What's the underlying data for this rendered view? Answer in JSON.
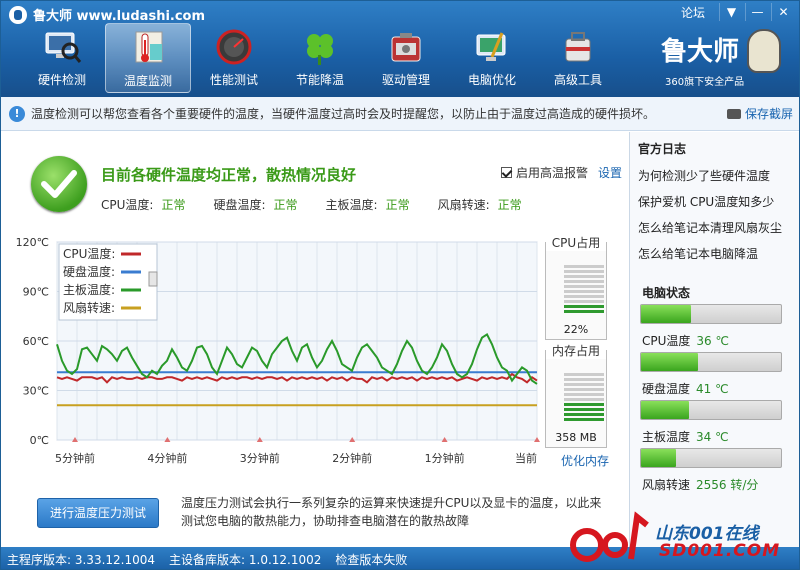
{
  "app": {
    "title": "鲁大师 www.ludashi.com",
    "forum_link": "论坛",
    "win_controls": {
      "menu": "▼",
      "minimize": "—",
      "close": "✕"
    },
    "brand": "鲁大师",
    "brand_sub": "360旗下安全产品"
  },
  "nav": [
    {
      "label": "硬件检测",
      "icon": "monitor-magnifier-icon",
      "active": false
    },
    {
      "label": "温度监测",
      "icon": "thermometer-icon",
      "active": true
    },
    {
      "label": "性能测试",
      "icon": "gauge-icon",
      "active": false
    },
    {
      "label": "节能降温",
      "icon": "clover-icon",
      "active": false
    },
    {
      "label": "驱动管理",
      "icon": "toolbox-icon",
      "active": false
    },
    {
      "label": "电脑优化",
      "icon": "broom-monitor-icon",
      "active": false
    },
    {
      "label": "高级工具",
      "icon": "toolkit-icon",
      "active": false
    }
  ],
  "infobar": {
    "text": "温度检测可以帮您查看各个重要硬件的温度，当硬件温度过高时会及时提醒您，以防止由于温度过高造成的硬件损坏。",
    "save_label": "保存截屏"
  },
  "status": {
    "title": "目前各硬件温度均正常，散热情况良好",
    "items": [
      {
        "label": "CPU温度:",
        "value": "正常"
      },
      {
        "label": "硬盘温度:",
        "value": "正常"
      },
      {
        "label": "主板温度:",
        "value": "正常"
      },
      {
        "label": "风扇转速:",
        "value": "正常"
      }
    ],
    "alarm_label": "启用高温报警",
    "settings_label": "设置"
  },
  "chart_data": {
    "type": "line",
    "ylim": [
      0,
      120
    ],
    "ytick_labels": [
      "120℃",
      "90℃",
      "60℃",
      "30℃",
      "0℃"
    ],
    "yticks": [
      120,
      90,
      60,
      30,
      0
    ],
    "x_categories": [
      "5分钟前",
      "4分钟前",
      "3分钟前",
      "2分钟前",
      "1分钟前",
      "当前"
    ],
    "legend": [
      {
        "name": "CPU温度:",
        "color": "#c0282a"
      },
      {
        "name": "硬盘温度:",
        "color": "#3a7cd0"
      },
      {
        "name": "主板温度:",
        "color": "#2a9a2a"
      },
      {
        "name": "风扇转速:",
        "color": "#c8a020"
      }
    ],
    "series": [
      {
        "name": "CPU温度",
        "color": "#c0282a",
        "values": [
          38,
          37,
          38,
          37,
          36,
          38,
          38,
          38,
          37,
          38,
          35,
          38,
          37,
          38,
          37,
          37,
          38,
          37,
          38,
          38,
          37,
          37,
          38,
          38,
          37,
          36,
          38,
          37,
          38,
          37,
          38,
          37,
          36,
          38,
          37,
          38,
          37,
          38,
          38,
          37,
          38,
          37,
          38,
          38,
          37,
          38,
          36,
          38,
          37,
          38,
          37,
          38,
          37,
          38,
          36,
          38,
          37,
          38,
          36,
          38,
          37,
          37,
          35,
          38,
          37,
          38,
          36,
          38,
          37,
          38,
          37,
          38,
          36,
          38,
          37,
          38,
          37,
          38,
          37,
          38,
          36,
          37,
          38,
          37,
          36,
          38,
          37,
          38,
          37,
          38,
          37,
          40,
          38,
          37,
          35,
          38,
          36
        ]
      },
      {
        "name": "硬盘温度",
        "color": "#3a7cd0",
        "values": [
          41,
          41,
          41,
          41,
          41,
          41,
          41,
          41,
          41,
          41,
          41,
          41,
          41,
          41,
          41,
          41,
          41,
          41,
          41,
          41,
          41,
          41,
          41,
          41,
          41,
          41,
          41,
          41,
          41,
          41,
          41,
          41,
          41,
          41,
          41,
          41,
          41,
          41,
          41,
          41,
          41,
          41,
          41,
          41,
          41,
          41,
          41,
          41,
          41,
          41,
          41,
          41,
          41,
          41,
          41,
          41,
          41,
          41,
          41,
          41,
          41,
          41,
          41,
          41,
          41,
          41,
          41,
          41,
          41,
          41,
          41,
          41,
          41,
          41,
          41,
          41,
          41,
          41,
          41,
          41,
          41,
          41,
          41,
          41,
          41,
          41,
          41,
          41,
          41,
          41,
          41,
          41,
          41,
          41,
          41,
          41,
          41
        ]
      },
      {
        "name": "主板温度",
        "color": "#2a9a2a",
        "values": [
          58,
          48,
          42,
          40,
          43,
          55,
          56,
          52,
          48,
          57,
          55,
          52,
          48,
          54,
          56,
          50,
          45,
          40,
          38,
          42,
          40,
          45,
          48,
          55,
          50,
          44,
          42,
          48,
          56,
          57,
          52,
          44,
          40,
          48,
          56,
          52,
          46,
          44,
          50,
          56,
          54,
          48,
          44,
          52,
          56,
          60,
          62,
          54,
          48,
          56,
          58,
          50,
          44,
          48,
          55,
          60,
          54,
          46,
          44,
          42,
          50,
          56,
          58,
          54,
          50,
          44,
          42,
          40,
          46,
          54,
          60,
          56,
          48,
          42,
          40,
          44,
          50,
          58,
          54,
          46,
          40,
          38,
          40,
          46,
          55,
          62,
          64,
          58,
          50,
          44,
          42,
          36,
          40,
          44,
          42,
          36,
          34
        ]
      },
      {
        "name": "风扇转速",
        "color": "#c8a020",
        "values": [
          21,
          21,
          21,
          21,
          21,
          21,
          21,
          21,
          21,
          21,
          21,
          21,
          21,
          21,
          21,
          21,
          21,
          21,
          21,
          21,
          21,
          21,
          21,
          21,
          21,
          21,
          21,
          21,
          21,
          21,
          21,
          21,
          21,
          21,
          21,
          21,
          21,
          21,
          21,
          21,
          21,
          21,
          21,
          21,
          21,
          21,
          21,
          21,
          21,
          21,
          21,
          21,
          21,
          21,
          21,
          21,
          21,
          21,
          21,
          21,
          21,
          21,
          21,
          21,
          21,
          21,
          21,
          21,
          21,
          21,
          21,
          21,
          21,
          21,
          21,
          21,
          21,
          21,
          21,
          21,
          21,
          21,
          21,
          21,
          21,
          21,
          21,
          21,
          21,
          21,
          21,
          21,
          21,
          21,
          21,
          21,
          21
        ]
      }
    ]
  },
  "cpu_usage": {
    "caption": "CPU占用",
    "value": "22%",
    "fraction": 0.22
  },
  "mem_usage": {
    "caption": "内存占用",
    "value": "358 MB",
    "fraction": 0.35
  },
  "optimize_mem": "优化内存",
  "stress": {
    "button": "进行温度压力测试",
    "desc": "温度压力测试会执行一系列复杂的运算来快速提升CPU以及显卡的温度，以此来测试您电脑的散热能力，协助排查电脑潜在的散热故障"
  },
  "sidebar": {
    "log_title": "官方日志",
    "logs": [
      "为何检测少了些硬件温度",
      "保护爱机 CPU温度知多少",
      "怎么给笔记本清理风扇灰尘",
      "怎么给笔记本电脑降温"
    ],
    "status_title": "电脑状态",
    "status": [
      {
        "label": "CPU温度",
        "value": "36 ℃",
        "fraction": 0.36
      },
      {
        "label": "硬盘温度",
        "value": "41 ℃",
        "fraction": 0.41
      },
      {
        "label": "主板温度",
        "value": "34 ℃",
        "fraction": 0.34
      },
      {
        "label": "风扇转速",
        "value": "2556 转/分",
        "fraction": 0.25
      }
    ]
  },
  "footer": {
    "main_version": "主程序版本: 3.33.12.1004",
    "db_version": "主设备库版本: 1.0.12.1002",
    "check_version": "检查版本失败"
  },
  "watermark": {
    "line1": "山东001在线",
    "line2": "SD001.COM"
  }
}
